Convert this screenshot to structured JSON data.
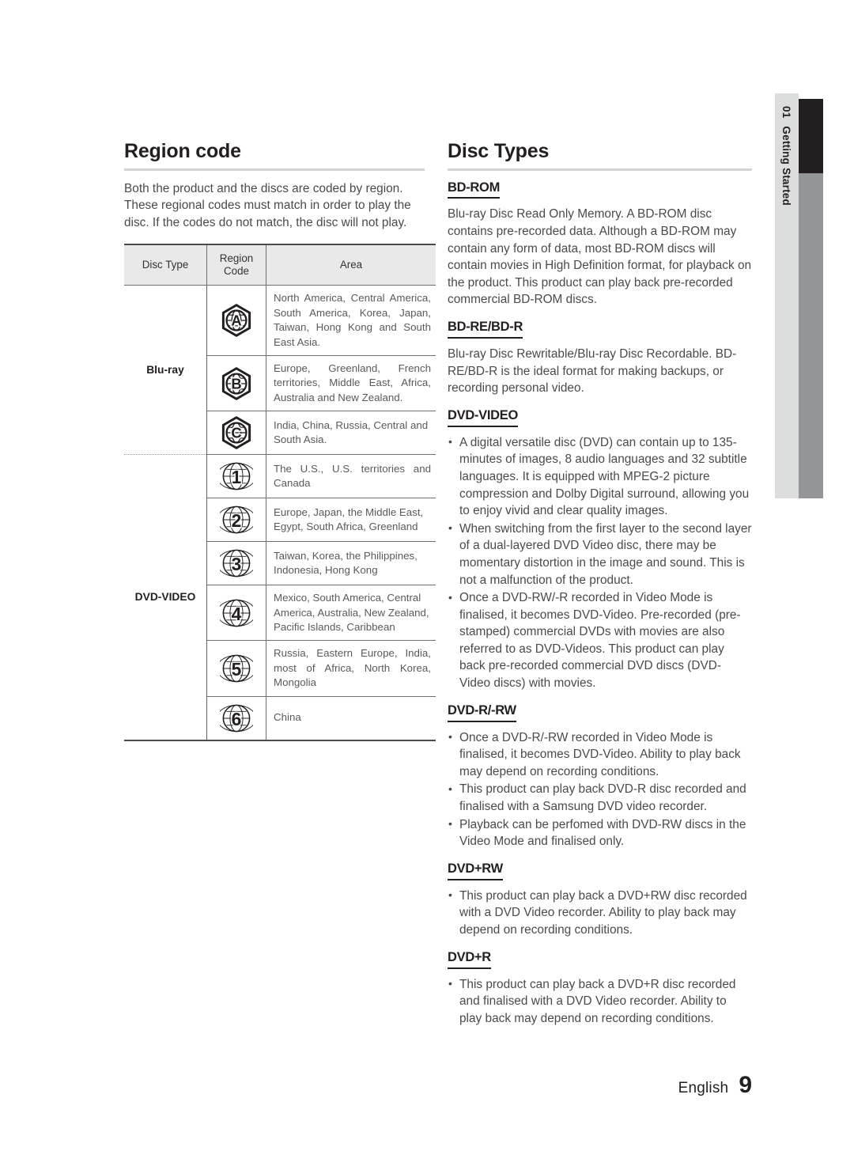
{
  "side_tab": {
    "chapter_number": "01",
    "chapter_label": "Getting Started"
  },
  "footer": {
    "language": "English",
    "page_number": "9"
  },
  "left_column": {
    "title": "Region code",
    "intro": "Both the product and the discs are coded by region. These regional codes must match in order to play the disc. If the codes do not match, the disc will not play.",
    "table": {
      "headers": {
        "disc_type": "Disc Type",
        "region_code": "Region Code",
        "area": "Area"
      },
      "groups": [
        {
          "disc_type": "Blu-ray",
          "icon_style": "hexagon-globe",
          "rows": [
            {
              "code": "A",
              "area": "North America, Central America, South America, Korea, Japan, Taiwan, Hong Kong and South East Asia.",
              "justify": true
            },
            {
              "code": "B",
              "area": "Europe, Greenland, French territories, Middle East, Africa, Australia and New Zealand.",
              "justify": true
            },
            {
              "code": "C",
              "area": "India, China, Russia, Central and South Asia.",
              "justify": false
            }
          ]
        },
        {
          "disc_type": "DVD-VIDEO",
          "icon_style": "circle-globe",
          "rows": [
            {
              "code": "1",
              "area": "The U.S., U.S. territories and Canada",
              "justify": true
            },
            {
              "code": "2",
              "area": "Europe, Japan, the Middle East, Egypt, South Africa, Greenland",
              "justify": false
            },
            {
              "code": "3",
              "area": "Taiwan, Korea, the Philippines, Indonesia, Hong Kong",
              "justify": false
            },
            {
              "code": "4",
              "area": "Mexico, South America, Central America, Australia, New Zealand, Pacific Islands, Caribbean",
              "justify": false
            },
            {
              "code": "5",
              "area": "Russia, Eastern Europe, India, most of Africa, North Korea, Mongolia",
              "justify": true
            },
            {
              "code": "6",
              "area": "China",
              "justify": false
            }
          ]
        }
      ]
    }
  },
  "right_column": {
    "title": "Disc Types",
    "sections": [
      {
        "heading": "BD-ROM",
        "kind": "paragraph",
        "paragraphs": [
          "Blu-ray Disc Read Only Memory. A BD-ROM disc contains pre-recorded data. Although a BD-ROM may contain any form of data, most BD-ROM discs will contain movies in High Definition format, for playback on the product. This product can play back pre-recorded commercial BD-ROM discs."
        ]
      },
      {
        "heading": "BD-RE/BD-R",
        "kind": "paragraph",
        "paragraphs": [
          "Blu-ray Disc Rewritable/Blu-ray Disc Recordable. BD-RE/BD-R is the ideal format for making backups, or recording personal video."
        ]
      },
      {
        "heading": "DVD-VIDEO",
        "kind": "bullets",
        "bullets": [
          "A digital versatile disc (DVD) can contain up to 135-minutes of images, 8 audio languages and 32 subtitle languages. It is equipped with MPEG-2 picture compression and Dolby Digital surround, allowing you to enjoy vivid and clear quality images.",
          "When switching from the first layer to the second layer of a dual-layered DVD Video disc, there may be momentary distortion in the image and sound. This is not a malfunction of the product.",
          "Once a DVD-RW/-R recorded in Video Mode is finalised, it becomes DVD-Video. Pre-recorded (pre-stamped) commercial DVDs with movies are also referred to as DVD-Videos. This product can play back pre-recorded commercial DVD discs (DVD-Video discs) with movies."
        ]
      },
      {
        "heading": "DVD-R/-RW",
        "kind": "bullets",
        "bullets": [
          "Once a DVD-R/-RW recorded in Video Mode is finalised, it becomes DVD-Video. Ability to play back may depend on recording conditions.",
          "This product can play back DVD-R disc recorded and finalised with a Samsung DVD video recorder.",
          "Playback can be perfomed with DVD-RW discs in the Video Mode and finalised only."
        ]
      },
      {
        "heading": "DVD+RW",
        "kind": "bullets",
        "bullets": [
          "This product can play back a DVD+RW disc recorded with a DVD Video recorder. Ability to play back may depend on recording conditions."
        ]
      },
      {
        "heading": "DVD+R",
        "kind": "bullets",
        "bullets": [
          "This product can play back a DVD+R disc recorded and finalised with a DVD Video recorder. Ability to play back may depend on recording conditions."
        ]
      }
    ]
  },
  "colors": {
    "heading": "#231f20",
    "body_text": "#4a4a4a",
    "rule": "#d4d5d7",
    "table_header_bg": "#e9e9e9",
    "tab_bg": "#dcdddd",
    "tab_dark": "#231f20",
    "tab_gray": "#939598"
  }
}
